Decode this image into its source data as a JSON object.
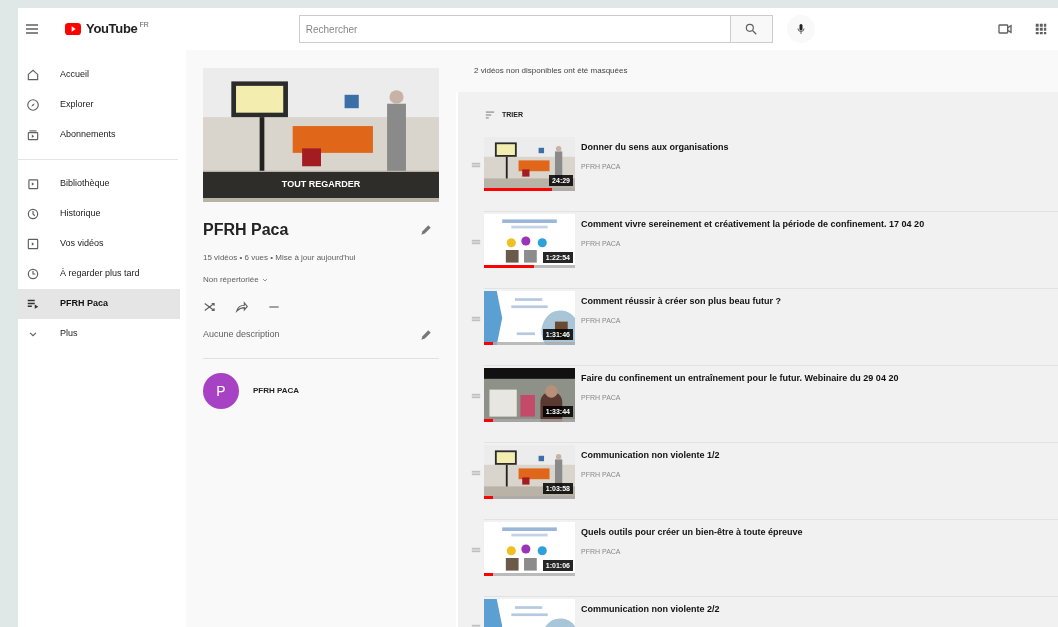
{
  "header": {
    "logo": "YouTube",
    "region": "FR",
    "search": {
      "placeholder": "Rechercher"
    }
  },
  "sidebar": {
    "sections": [
      {
        "items": [
          {
            "label": "Accueil",
            "selected": false
          },
          {
            "label": "Explorer",
            "selected": false
          },
          {
            "label": "Abonnements",
            "selected": false
          }
        ]
      },
      {
        "items": [
          {
            "label": "Bibliothèque",
            "selected": false
          },
          {
            "label": "Historique",
            "selected": false
          },
          {
            "label": "Vos vidéos",
            "selected": false
          },
          {
            "label": "À regarder plus tard",
            "selected": false
          },
          {
            "label": "PFRH Paca",
            "selected": true
          },
          {
            "label": "Plus",
            "selected": false
          }
        ]
      }
    ]
  },
  "playlist": {
    "play_all": "TOUT REGARDER",
    "title": "PFRH Paca",
    "stats": "15 vidéos • 6 vues • Mise à jour aujourd'hui",
    "privacy": "Non répertoriée",
    "description": "Aucune description",
    "owner": {
      "initial": "P",
      "name": "PFRH PACA"
    }
  },
  "videos_panel": {
    "notice": "2 vidéos non disponibles ont été masquées",
    "sort": "TRIER",
    "videos": [
      {
        "title": "Donner du sens aux organisations",
        "channel": "PFRH PACA",
        "duration": "24:29",
        "level": 0.75
      },
      {
        "title": "Comment vivre sereinement et créativement la période de confinement. 17 04 20",
        "channel": "PFRH PACA",
        "duration": "1:22:54",
        "level": 0.55
      },
      {
        "title": "Comment réussir à créer son plus beau futur ?",
        "channel": "PFRH PACA",
        "duration": "1:31:46",
        "level": 0.1
      },
      {
        "title": "Faire du confinement un entraînement pour le futur. Webinaire du 29 04 20",
        "channel": "PFRH PACA",
        "duration": "1:33:44",
        "level": 0.1
      },
      {
        "title": "Communication non violente 1/2",
        "channel": "PFRH PACA",
        "duration": "1:03:58",
        "level": 0.1
      },
      {
        "title": "Quels outils pour créer un bien-être à toute épreuve",
        "channel": "PFRH PACA",
        "duration": "1:01:06",
        "level": 0.1
      },
      {
        "title": "Communication non violente 2/2"
      }
    ]
  }
}
